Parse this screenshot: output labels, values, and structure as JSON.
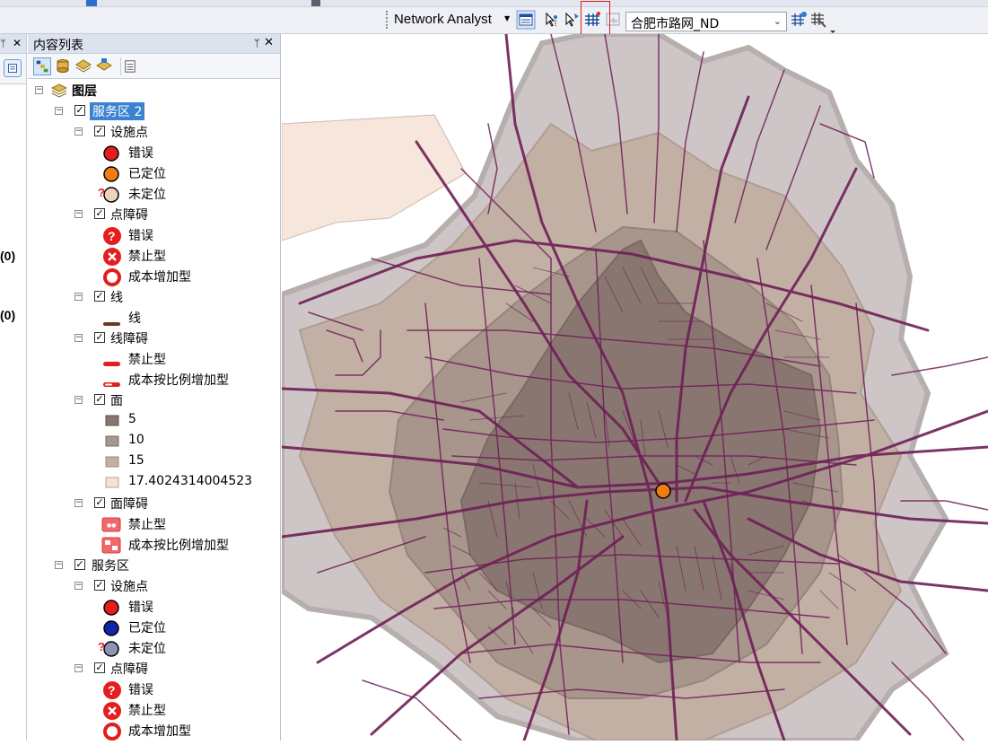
{
  "toolbar": {
    "network_analyst_label": "Network Analyst",
    "network_dataset": "合肥市路网_ND"
  },
  "left_panel": {
    "counts": [
      "(0)",
      "(0)"
    ]
  },
  "toc": {
    "title": "内容列表",
    "root": "图层",
    "service_area_2": {
      "name": "服务区 2",
      "facilities": {
        "name": "设施点",
        "items": [
          "错误",
          "已定位",
          "未定位"
        ]
      },
      "point_barriers": {
        "name": "点障碍",
        "items": [
          "错误",
          "禁止型",
          "成本增加型"
        ]
      },
      "lines": {
        "name": "线",
        "items": [
          "线"
        ]
      },
      "line_barriers": {
        "name": "线障碍",
        "items": [
          "禁止型",
          "成本按比例增加型"
        ]
      },
      "polygons": {
        "name": "面",
        "items": [
          "5",
          "10",
          "15",
          "17.4024314004523"
        ]
      },
      "polygon_barriers": {
        "name": "面障碍",
        "items": [
          "禁止型",
          "成本按比例增加型"
        ]
      }
    },
    "service_area": {
      "name": "服务区",
      "facilities": {
        "name": "设施点",
        "items": [
          "错误",
          "已定位",
          "未定位"
        ]
      },
      "point_barriers": {
        "name": "点障碍",
        "items": [
          "错误",
          "禁止型",
          "成本增加型"
        ]
      }
    }
  },
  "colors": {
    "ring1": "#8a7670",
    "ring2": "#a8958c",
    "ring3": "#c3b0a5",
    "ring4": "#f3e2d8",
    "roads": "#6e1f57",
    "facility": "#f07d10",
    "error_red": "#e51d1d",
    "selection_blue": "#3b83d1",
    "highlight_box": "#e01c1c"
  }
}
